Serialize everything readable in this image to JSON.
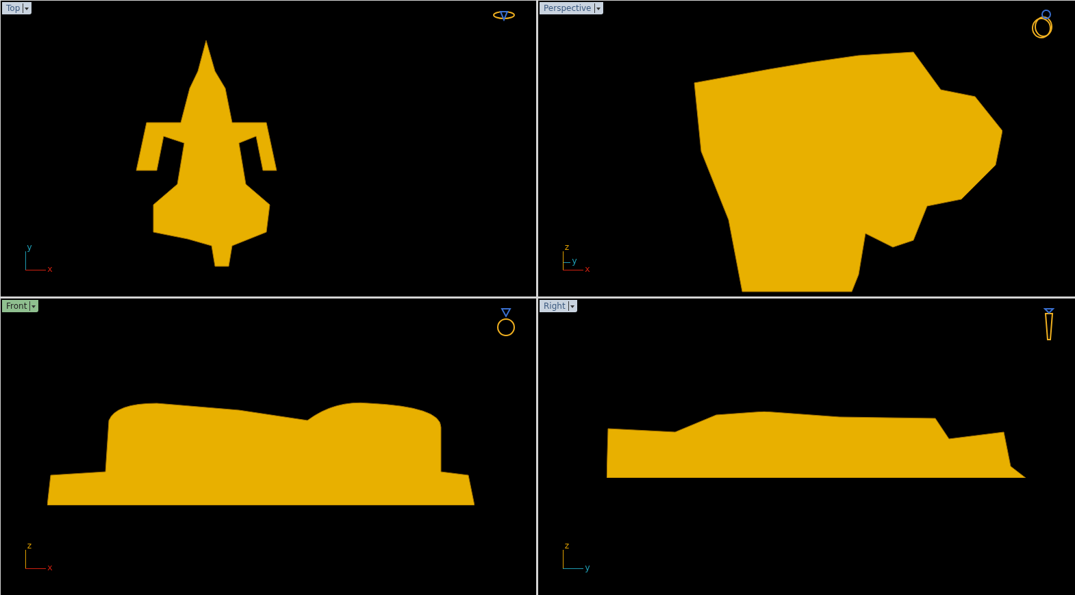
{
  "viewports": [
    {
      "kind": "top",
      "label": "Top",
      "selected": false,
      "axes": [
        {
          "label": "y",
          "color": "#1e9ab0"
        },
        {
          "label": "x",
          "color": "#d02010"
        }
      ]
    },
    {
      "kind": "perspective",
      "label": "Perspective",
      "selected": false,
      "axes": [
        {
          "label": "z",
          "color": "#e0a000"
        },
        {
          "label": "y",
          "color": "#1e9ab0"
        },
        {
          "label": "x",
          "color": "#d02010"
        }
      ]
    },
    {
      "kind": "front",
      "label": "Front",
      "selected": true,
      "axes": [
        {
          "label": "z",
          "color": "#e0a000"
        },
        {
          "label": "x",
          "color": "#d02010"
        }
      ]
    },
    {
      "kind": "right",
      "label": "Right",
      "selected": false,
      "axes": [
        {
          "label": "z",
          "color": "#e0a000"
        },
        {
          "label": "y",
          "color": "#1e9ab0"
        }
      ]
    }
  ]
}
